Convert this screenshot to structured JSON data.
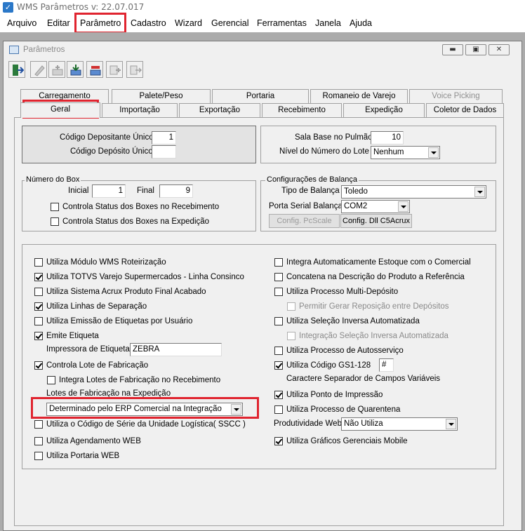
{
  "app": {
    "title": "WMS Parâmetros  v: 22.07.017"
  },
  "menu": [
    "Arquivo",
    "Editar",
    "Parâmetro",
    "Cadastro",
    "Wizard",
    "Gerencial",
    "Ferramentas",
    "Janela",
    "Ajuda"
  ],
  "window": {
    "title": "Parâmetros"
  },
  "toolbar": [
    "exit-icon",
    "clear-icon",
    "add-icon",
    "save-icon",
    "delete-icon",
    "copy-icon",
    "export-icon"
  ],
  "tabs_row1": [
    {
      "label": "Carregamento",
      "disabled": false
    },
    {
      "label": "Palete/Peso",
      "disabled": false
    },
    {
      "label": "Portaria",
      "disabled": false
    },
    {
      "label": "Romaneio de Varejo",
      "disabled": false
    },
    {
      "label": "Voice Picking",
      "disabled": true
    }
  ],
  "tabs_row2": [
    {
      "label": "Geral",
      "active": true
    },
    {
      "label": "Importação"
    },
    {
      "label": "Exportação"
    },
    {
      "label": "Recebimento"
    },
    {
      "label": "Expedição"
    },
    {
      "label": "Coletor de Dados"
    }
  ],
  "deposit": {
    "codigo_depositante_label": "Código Depositante Único",
    "codigo_depositante_value": "1",
    "codigo_deposito_label": "Código Depósito Único",
    "codigo_deposito_value": ""
  },
  "pulmao": {
    "sala_base_label": "Sala Base no Pulmão",
    "sala_base_value": "10",
    "nivel_lote_label": "Nível do Número do Lote",
    "nivel_lote_value": "Nenhum"
  },
  "box": {
    "title": "Número do Box",
    "inicial_label": "Inicial",
    "inicial_value": "1",
    "final_label": "Final",
    "final_value": "9",
    "status_recebimento": "Controla Status dos Boxes no Recebimento",
    "status_expedicao": "Controla Status dos Boxes na Expedição"
  },
  "balanca": {
    "title": "Configurações de Balança",
    "tipo_label": "Tipo de Balança",
    "tipo_value": "Toledo",
    "porta_label": "Porta Serial Balança",
    "porta_value": "COM2",
    "config_pcscale": "Config. PcScale",
    "config_dll": "Config. Dll C5Acrux"
  },
  "left_options": {
    "roteirizacao": "Utiliza Módulo WMS Roteirização",
    "totvs": "Utiliza TOTVS Varejo Supermercados - Linha Consinco",
    "acrux": "Utiliza Sistema Acrux Produto Final Acabado",
    "linhas": "Utiliza Linhas de Separação",
    "emissao": "Utiliza Emissão de Etiquetas por Usuário",
    "emite_etiqueta": "Emite Etiqueta",
    "impressora_label": "Impressora de Etiquetas",
    "impressora_value": "ZEBRA",
    "controla_lote": "Controla Lote de Fabricação",
    "integra_lotes": "Integra  Lotes de Fabricação no Recebimento",
    "lotes_expedicao_label": "Lotes de Fabricação na Expedição",
    "lotes_expedicao_value": "Determinado pelo ERP Comercial na Integração",
    "sscc": "Utiliza o Código de Série da Unidade Logística( SSCC )",
    "agendamento": "Utiliza Agendamento WEB",
    "portaria": "Utiliza Portaria WEB"
  },
  "right_options": {
    "integra_estoque": "Integra Automaticamente Estoque com o Comercial",
    "concatena": "Concatena na Descrição do Produto a Referência",
    "multi_deposito": "Utiliza Processo Multi-Depósito",
    "permitir_reposicao": "Permitir Gerar Reposição entre Depósitos",
    "selecao_inversa": "Utiliza Seleção Inversa Automatizada",
    "integracao_selecao": "Integração Seleção Inversa Automatizada",
    "autosservico": "Utiliza Processo de Autosserviço",
    "gs1": "Utiliza Código GS1-128",
    "gs1_value": "#",
    "separador": "Caractere Separador de Campos Variáveis",
    "ponto_impressao": "Utiliza Ponto de Impressão",
    "quarentena": "Utiliza Processo de Quarentena",
    "produtividade_label": "Produtividade Web",
    "produtividade_value": "Não Utiliza",
    "graficos": "Utiliza Gráficos Gerenciais Mobile"
  }
}
